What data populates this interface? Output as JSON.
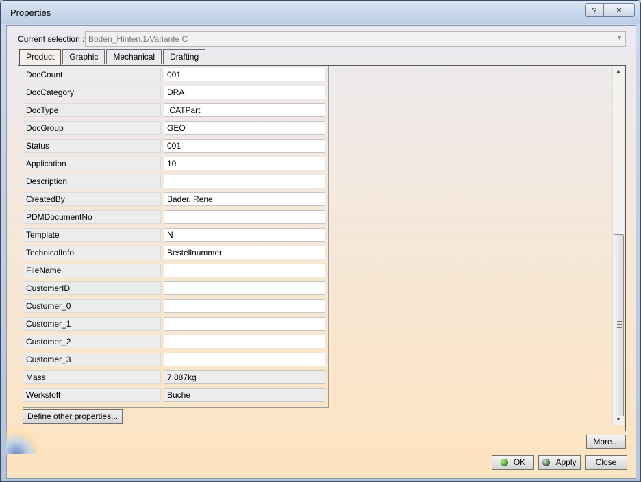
{
  "window": {
    "title": "Properties"
  },
  "titlebar": {
    "help_glyph": "?",
    "close_glyph": "✕"
  },
  "selection": {
    "label": "Current selection :",
    "value": "Boden_Hinten.1/Variante C"
  },
  "tabs": [
    {
      "label": "Product"
    },
    {
      "label": "Graphic"
    },
    {
      "label": "Mechanical"
    },
    {
      "label": "Drafting"
    }
  ],
  "properties": [
    {
      "name": "DocCount",
      "value": "001"
    },
    {
      "name": "DocCategory",
      "value": "DRA"
    },
    {
      "name": "DocType",
      "value": ".CATPart"
    },
    {
      "name": "DocGroup",
      "value": "GEO"
    },
    {
      "name": "Status",
      "value": "001"
    },
    {
      "name": "Application",
      "value": "10"
    },
    {
      "name": "Description",
      "value": ""
    },
    {
      "name": "CreatedBy",
      "value": "Bader, Rene"
    },
    {
      "name": "PDMDocumentNo",
      "value": ""
    },
    {
      "name": "Template",
      "value": "N"
    },
    {
      "name": "TechnicalInfo",
      "value": "Bestellnummer"
    },
    {
      "name": "FileName",
      "value": ""
    },
    {
      "name": "CustomerID",
      "value": ""
    },
    {
      "name": "Customer_0",
      "value": ""
    },
    {
      "name": "Customer_1",
      "value": ""
    },
    {
      "name": "Customer_2",
      "value": ""
    },
    {
      "name": "Customer_3",
      "value": ""
    },
    {
      "name": "Mass",
      "value": "7,887kg"
    },
    {
      "name": "Werkstoff",
      "value": "Buche"
    }
  ],
  "buttons": {
    "define_other": "Define other properties...",
    "more": "More...",
    "ok": "OK",
    "apply": "Apply",
    "close": "Close"
  }
}
